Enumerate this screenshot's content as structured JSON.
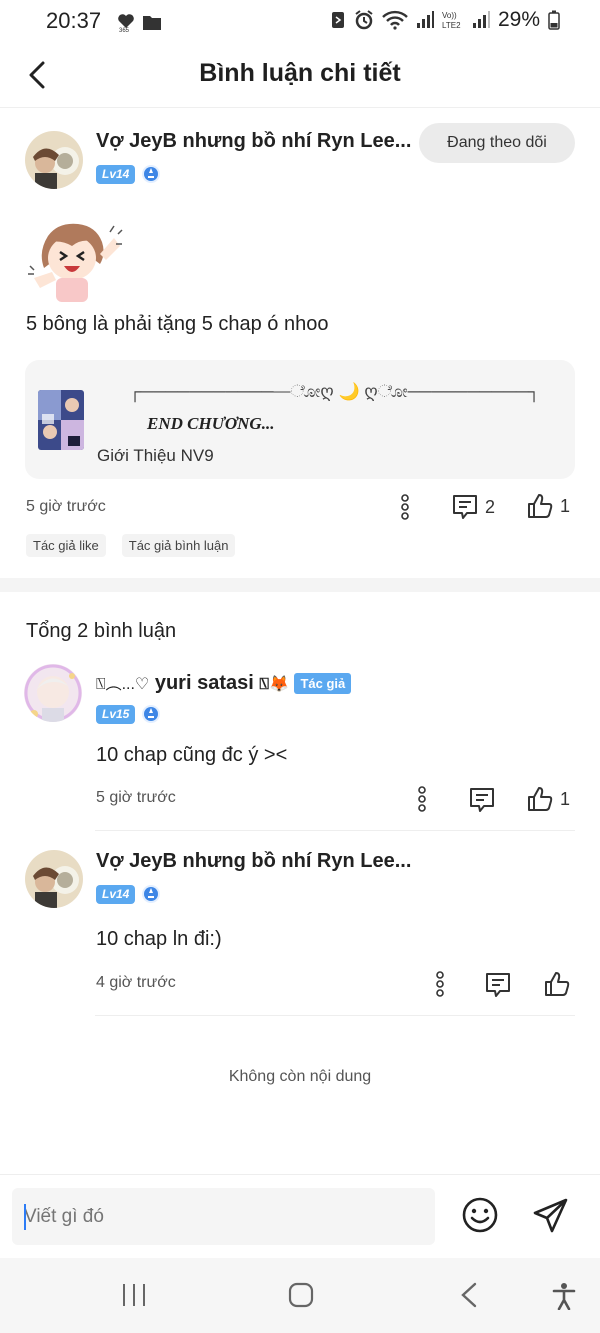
{
  "status_bar": {
    "time": "20:37",
    "battery": "29%",
    "icons": [
      "heart-365-icon",
      "folder-icon",
      "nfc-icon",
      "alarm-icon",
      "wifi-icon",
      "signal-icon",
      "volte-icon",
      "signal-icon",
      "battery-icon"
    ]
  },
  "header": {
    "title": "Bình luận chi tiết",
    "back_icon": "chevron-left-icon"
  },
  "post": {
    "author": "Vợ JeyB nhưng bồ nhí Ryn Lee...",
    "level": "Lv14",
    "follow_label": "Đang theo dõi",
    "text": "5 bông là phải tặng 5 chap ó nhoo",
    "shared": {
      "decor": "┌────────────ೋღ 🌙 ღೋ──────────┐",
      "end_text": "END CHƯƠNG...",
      "name": "Giới Thiệu NV9"
    },
    "time": "5 giờ trước",
    "reply_count": "2",
    "like_count": "1",
    "tags": [
      "Tác giả like",
      "Tác giả bình luận"
    ]
  },
  "total_label": "Tổng 2 bình luận",
  "comments": [
    {
      "author_prefix": "⍂︵...♡",
      "author": "yuri satasi",
      "author_suffix": "⍂🦊",
      "author_tag": "Tác giả",
      "level": "Lv15",
      "text": "10 chap cũng đc ý ><",
      "time": "5 giờ trước",
      "like_count": "1"
    },
    {
      "author": "Vợ JeyB nhưng bồ nhí Ryn Lee...",
      "level": "Lv14",
      "text": "10 chap ln đi:)",
      "time": "4 giờ trước",
      "like_count": ""
    }
  ],
  "no_more_label": "Không còn nội dung",
  "input": {
    "placeholder": "Viết gì đó"
  },
  "colors": {
    "accent": "#5aa8f0",
    "level_badge": "#5aa8f0",
    "cursor": "#2d7cf6"
  }
}
